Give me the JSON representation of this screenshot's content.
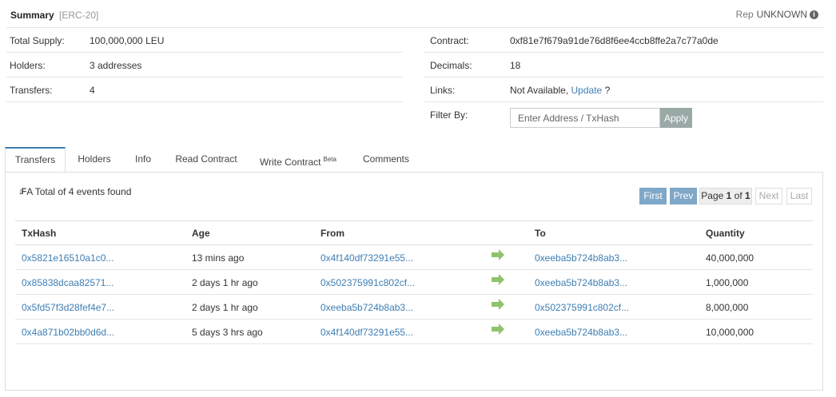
{
  "summary": {
    "title": "Summary",
    "tag": "[ERC-20]",
    "rep_label": "Rep",
    "rep_value": "UNKNOWN"
  },
  "overview_left": [
    {
      "label": "Total Supply:",
      "value": "100,000,000 LEU"
    },
    {
      "label": "Holders:",
      "value": "3 addresses"
    },
    {
      "label": "Transfers:",
      "value": "4"
    }
  ],
  "overview_right": {
    "contract_label": "Contract:",
    "contract_value": "0xf81e7f679a91de76d8f6ee4ccb8ffe2a7c77a0de",
    "decimals_label": "Decimals:",
    "decimals_value": "18",
    "links_label": "Links:",
    "links_not_available": "Not Available,",
    "links_update": "Update",
    "links_q": "?",
    "filter_label": "Filter By:",
    "filter_placeholder": "Enter Address / TxHash",
    "apply_label": "Apply"
  },
  "tabs": [
    {
      "label": "Transfers",
      "active": true
    },
    {
      "label": "Holders"
    },
    {
      "label": "Info"
    },
    {
      "label": "Read Contract"
    },
    {
      "label": "Write Contract",
      "badge": "Beta"
    },
    {
      "label": "Comments"
    }
  ],
  "events": {
    "total_text": "A Total of 4 events found"
  },
  "pager": {
    "first": "First",
    "prev": "Prev",
    "page_prefix": "Page",
    "page_current": "1",
    "page_of": "of",
    "page_total": "1",
    "next": "Next",
    "last": "Last"
  },
  "table": {
    "headers": {
      "txhash": "TxHash",
      "age": "Age",
      "from": "From",
      "to": "To",
      "quantity": "Quantity"
    },
    "rows": [
      {
        "txhash": "0x5821e16510a1c0...",
        "age": "13 mins ago",
        "from": "0x4f140df73291e55...",
        "to": "0xeeba5b724b8ab3...",
        "quantity": "40,000,000"
      },
      {
        "txhash": "0x85838dcaa82571...",
        "age": "2 days 1 hr ago",
        "from": "0x502375991c802cf...",
        "to": "0xeeba5b724b8ab3...",
        "quantity": "1,000,000"
      },
      {
        "txhash": "0x5fd57f3d28fef4e7...",
        "age": "2 days 1 hr ago",
        "from": "0xeeba5b724b8ab3...",
        "to": "0x502375991c802cf...",
        "quantity": "8,000,000"
      },
      {
        "txhash": "0x4a871b02bb0d6d...",
        "age": "5 days 3 hrs ago",
        "from": "0x4f140df73291e55...",
        "to": "0xeeba5b724b8ab3...",
        "quantity": "10,000,000"
      }
    ]
  },
  "colors": {
    "link": "#3e7eb3",
    "arrow": "#8fc36b",
    "pager_active": "#7fa7c8"
  }
}
